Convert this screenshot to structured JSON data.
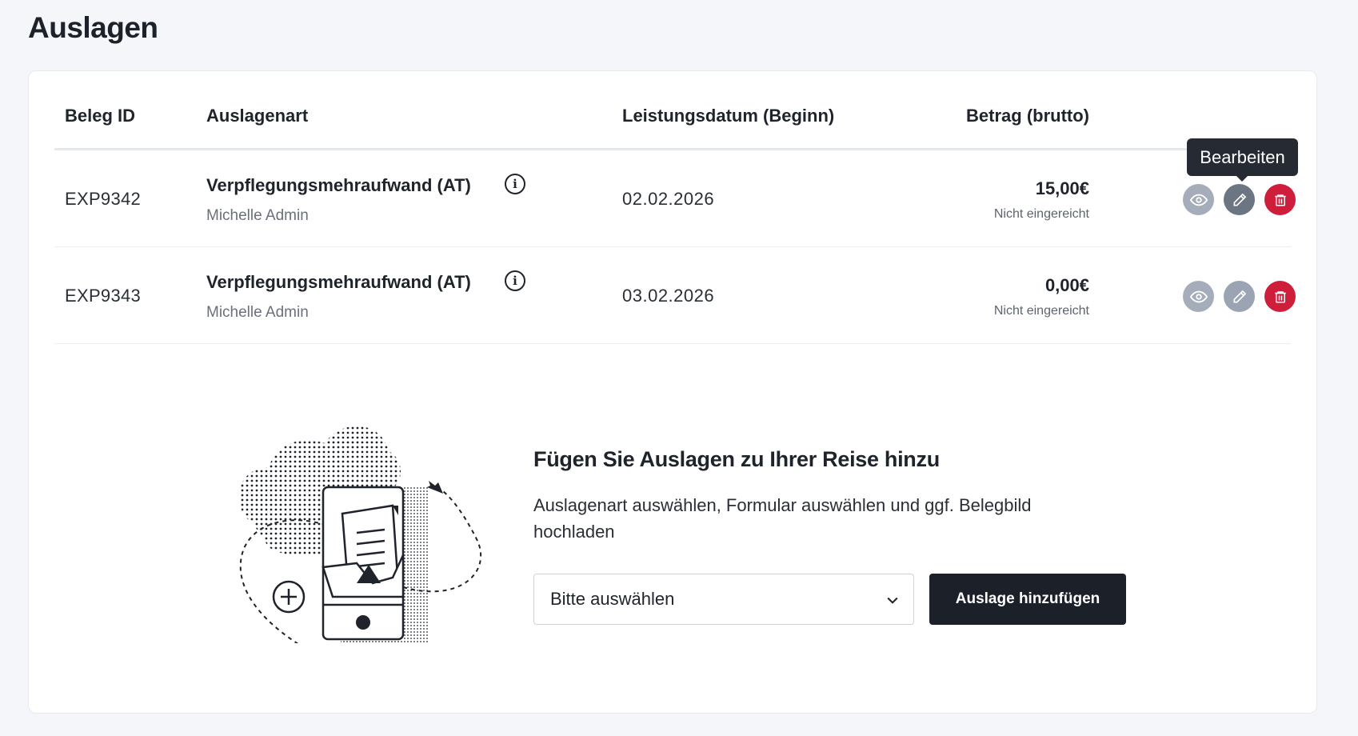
{
  "page": {
    "title": "Auslagen"
  },
  "table": {
    "headers": {
      "id": "Beleg ID",
      "type": "Auslagenart",
      "date": "Leistungsdatum (Beginn)",
      "amount": "Betrag (brutto)"
    },
    "rows": [
      {
        "id": "EXP9342",
        "type": "Verpflegungsmehraufwand (AT)",
        "person": "Michelle Admin",
        "date": "02.02.2026",
        "amount": "15,00€",
        "status": "Nicht eingereicht"
      },
      {
        "id": "EXP9343",
        "type": "Verpflegungsmehraufwand (AT)",
        "person": "Michelle Admin",
        "date": "03.02.2026",
        "amount": "0,00€",
        "status": "Nicht eingereicht"
      }
    ],
    "tooltip": "Bearbeiten"
  },
  "empty_state": {
    "title": "Fügen Sie Auslagen zu Ihrer Reise hinzu",
    "description": "Auslagenart auswählen, Formular auswählen und ggf. Belegbild hochladen",
    "select_placeholder": "Bitte auswählen",
    "add_button": "Auslage hinzufügen"
  },
  "icons": {
    "info": "info-icon",
    "view": "eye-icon",
    "edit": "pencil-icon",
    "delete": "trash-icon",
    "dropdown": "chevron-down-icon"
  },
  "colors": {
    "delete_accent": "#cf1d3c",
    "primary_button": "#1c2129",
    "tooltip_bg": "#262b33"
  }
}
